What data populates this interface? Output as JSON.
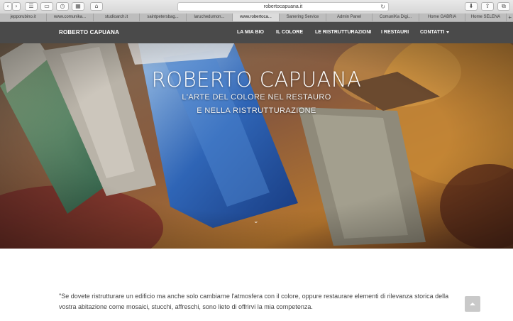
{
  "browser": {
    "url": "robertocapuana.it",
    "tabs": [
      {
        "label": "jepporubino.it"
      },
      {
        "label": "www.comunika..."
      },
      {
        "label": "studioarch.it"
      },
      {
        "label": "saintpetersbag..."
      },
      {
        "label": "laruchedumon..."
      },
      {
        "label": "www.robertoca...",
        "active": true
      },
      {
        "label": "Sanering Service"
      },
      {
        "label": "Admin Panel"
      },
      {
        "label": "ComuniKa Digi..."
      },
      {
        "label": "Home GABRIA"
      },
      {
        "label": "Home SELENA"
      }
    ],
    "new_tab": "+"
  },
  "navbar": {
    "brand": "ROBERTO CAPUANA",
    "items": [
      {
        "label": "LA MIA BIO"
      },
      {
        "label": "IL COLORE"
      },
      {
        "label": "LE RISTRUTTURAZIONI"
      },
      {
        "label": "I RESTAURI"
      },
      {
        "label": "CONTATTI"
      }
    ]
  },
  "hero": {
    "title": "ROBERTO CAPUANA",
    "subtitle_line1": "L'ARTE DEL COLORE NEL RESTAURO",
    "subtitle_line2": "E NELLA RISTRUTTURAZIONE"
  },
  "content": {
    "quote": "\"Se dovete ristrutturare un edificio ma anche solo cambiarne l'atmosfera con il colore, oppure restaurare elementi di rilevanza storica della vostra abitazione come mosaici, stucchi, affreschi, sono lieto di offrirvi la mia competenza."
  }
}
